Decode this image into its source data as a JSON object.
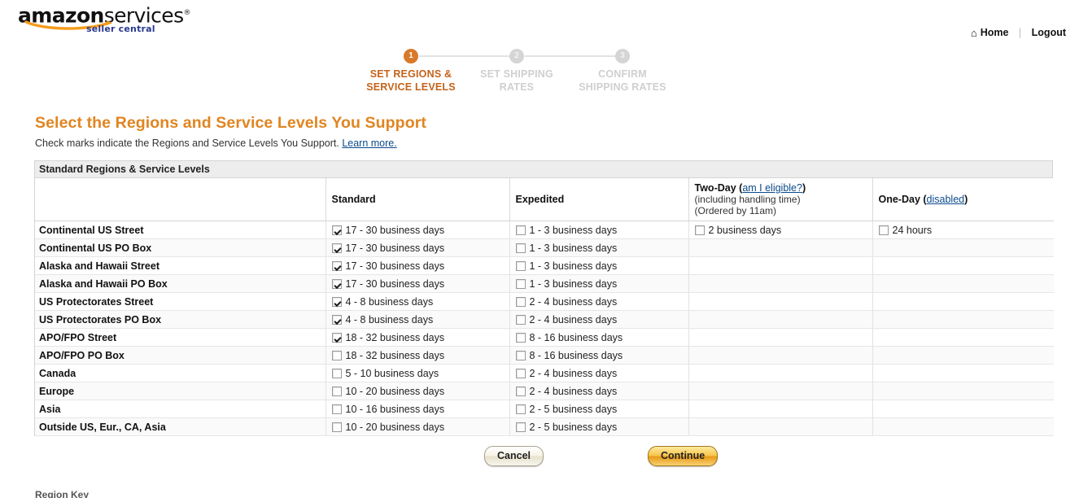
{
  "header": {
    "logo_amazon": "amazon",
    "logo_services": "services",
    "logo_sub": "seller central",
    "home_label": "Home",
    "home_icon": "house-icon",
    "separator": "|",
    "logout_label": "Logout"
  },
  "steps": [
    {
      "number": "1",
      "label": "SET REGIONS &\nSERVICE LEVELS",
      "state": "active"
    },
    {
      "number": "2",
      "label": "SET SHIPPING\nRATES",
      "state": "inactive"
    },
    {
      "number": "3",
      "label": "CONFIRM\nSHIPPING RATES",
      "state": "inactive"
    }
  ],
  "title": "Select the Regions and Service Levels You Support",
  "subtitle_text": "Check marks indicate the Regions and Service Levels You Support.",
  "subtitle_link": "Learn more.",
  "table": {
    "band_label": "Standard Regions & Service Levels",
    "columns": {
      "region": "",
      "standard": "Standard",
      "expedited": "Expedited",
      "twoday_title": "Two-Day",
      "twoday_link": "am I eligible?",
      "twoday_note1": "(including handling time)",
      "twoday_note2": "(Ordered by 11am)",
      "oneday_title": "One-Day",
      "oneday_link": "disabled"
    },
    "rows": [
      {
        "region": "Continental US Street",
        "standard": "17 - 30 business days",
        "standard_checked": true,
        "expedited": "1 - 3 business days",
        "expedited_checked": false,
        "twoday": "2 business days",
        "twoday_checked": false,
        "oneday": "24 hours",
        "oneday_checked": false
      },
      {
        "region": "Continental US PO Box",
        "standard": "17 - 30 business days",
        "standard_checked": true,
        "expedited": "1 - 3 business days",
        "expedited_checked": false,
        "twoday": "",
        "twoday_checked": null,
        "oneday": "",
        "oneday_checked": null
      },
      {
        "region": "Alaska and Hawaii Street",
        "standard": "17 - 30 business days",
        "standard_checked": true,
        "expedited": "1 - 3 business days",
        "expedited_checked": false,
        "twoday": "",
        "twoday_checked": null,
        "oneday": "",
        "oneday_checked": null
      },
      {
        "region": "Alaska and Hawaii PO Box",
        "standard": "17 - 30 business days",
        "standard_checked": true,
        "expedited": "1 - 3 business days",
        "expedited_checked": false,
        "twoday": "",
        "twoday_checked": null,
        "oneday": "",
        "oneday_checked": null
      },
      {
        "region": "US Protectorates Street",
        "standard": "4 - 8 business days",
        "standard_checked": true,
        "expedited": "2 - 4 business days",
        "expedited_checked": false,
        "twoday": "",
        "twoday_checked": null,
        "oneday": "",
        "oneday_checked": null
      },
      {
        "region": "US Protectorates PO Box",
        "standard": "4 - 8 business days",
        "standard_checked": true,
        "expedited": "2 - 4 business days",
        "expedited_checked": false,
        "twoday": "",
        "twoday_checked": null,
        "oneday": "",
        "oneday_checked": null
      },
      {
        "region": "APO/FPO Street",
        "standard": "18 - 32 business days",
        "standard_checked": true,
        "expedited": "8 - 16 business days",
        "expedited_checked": false,
        "twoday": "",
        "twoday_checked": null,
        "oneday": "",
        "oneday_checked": null
      },
      {
        "region": "APO/FPO PO Box",
        "standard": "18 - 32 business days",
        "standard_checked": false,
        "expedited": "8 - 16 business days",
        "expedited_checked": false,
        "twoday": "",
        "twoday_checked": null,
        "oneday": "",
        "oneday_checked": null
      },
      {
        "region": "Canada",
        "standard": "5 - 10 business days",
        "standard_checked": false,
        "expedited": "2 - 4 business days",
        "expedited_checked": false,
        "twoday": "",
        "twoday_checked": null,
        "oneday": "",
        "oneday_checked": null
      },
      {
        "region": "Europe",
        "standard": "10 - 20 business days",
        "standard_checked": false,
        "expedited": "2 - 4 business days",
        "expedited_checked": false,
        "twoday": "",
        "twoday_checked": null,
        "oneday": "",
        "oneday_checked": null
      },
      {
        "region": "Asia",
        "standard": "10 - 16 business days",
        "standard_checked": false,
        "expedited": "2 - 5 business days",
        "expedited_checked": false,
        "twoday": "",
        "twoday_checked": null,
        "oneday": "",
        "oneday_checked": null
      },
      {
        "region": "Outside US, Eur., CA, Asia",
        "standard": "10 - 20 business days",
        "standard_checked": false,
        "expedited": "2 - 5 business days",
        "expedited_checked": false,
        "twoday": "",
        "twoday_checked": null,
        "oneday": "",
        "oneday_checked": null
      }
    ]
  },
  "buttons": {
    "cancel": "Cancel",
    "continue": "Continue"
  },
  "bottom_note": "Region Key",
  "colors": {
    "accent_orange": "#e08521",
    "step_active": "#d9792a",
    "link_blue": "#0b4a8b",
    "logo_blue": "#2b3a8f"
  }
}
